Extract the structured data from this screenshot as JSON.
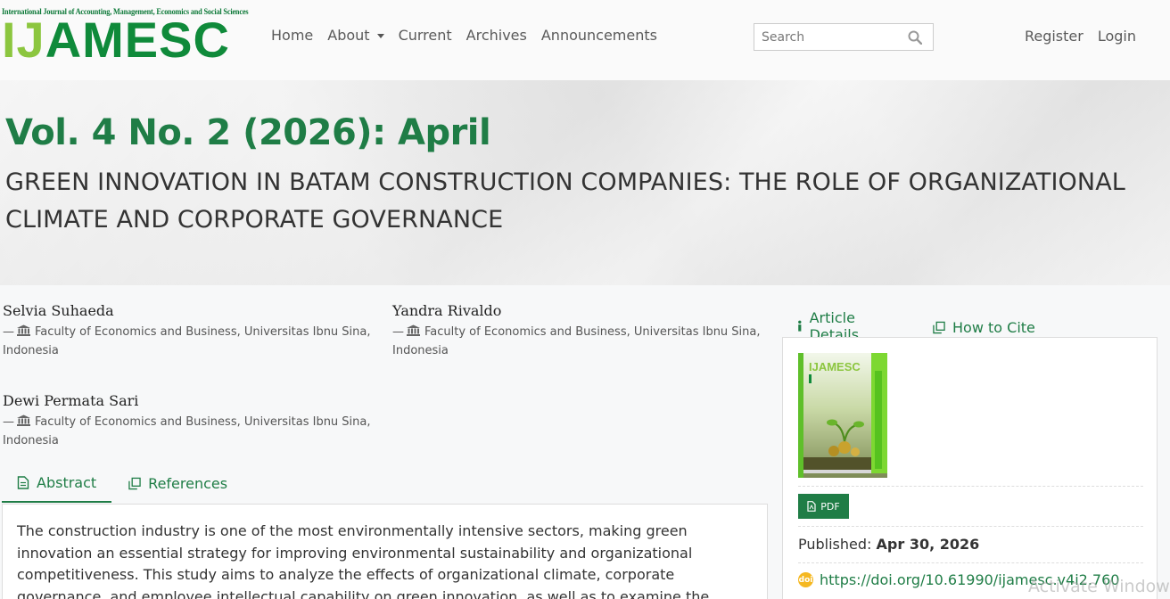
{
  "brand": {
    "tagline": "International Journal of Accounting, Management, Economics and Social Sciences",
    "wordmark_a": "IJ",
    "wordmark_b": "AMESC"
  },
  "nav": {
    "home": "Home",
    "about": "About",
    "current": "Current",
    "archives": "Archives",
    "announcements": "Announcements"
  },
  "search": {
    "placeholder": "Search"
  },
  "user_nav": {
    "register": "Register",
    "login": "Login"
  },
  "issue": {
    "title": "Vol. 4 No. 2 (2026): April",
    "article_title": "GREEN INNOVATION IN BATAM CONSTRUCTION COMPANIES: THE ROLE OF ORGANIZATIONAL CLIMATE AND CORPORATE GOVERNANCE"
  },
  "authors": [
    {
      "name": "Selvia Suhaeda",
      "dash": "—",
      "affiliation": "Faculty of Economics and Business, Universitas Ibnu Sina, Indonesia"
    },
    {
      "name": "Yandra Rivaldo",
      "dash": "—",
      "affiliation": "Faculty of Economics and Business, Universitas Ibnu Sina, Indonesia"
    },
    {
      "name": "Dewi Permata Sari",
      "dash": "—",
      "affiliation": "Faculty of Economics and Business, Universitas Ibnu Sina, Indonesia"
    }
  ],
  "content_tabs": {
    "abstract": "Abstract",
    "references": "References"
  },
  "abstract_text": "The construction industry is one of the most environmentally intensive sectors, making green innovation an essential strategy for improving environmental sustainability and organizational competitiveness. This study aims to analyze the effects of organizational climate, corporate governance, and employee intellectual capability on green innovation, as well as to examine the moderating role of green transformational leadership",
  "sidebar": {
    "tabs": {
      "details": "Article Details",
      "cite": "How to Cite"
    },
    "cover": {
      "brand": "IJAMESC",
      "subtitle": "International Journal of Accounting, Management, Economics and Social Sciences"
    },
    "pdf_label": "PDF",
    "published_label": "Published:",
    "published_date": "Apr 30, 2026",
    "doi_badge": "doi",
    "doi": "https://doi.org/10.61990/ijamesc.v4i2.760"
  },
  "watermark": "Activate Windows",
  "colors": {
    "primary": "#1f7d46",
    "brand_light": "#8cc63f",
    "brand_dark": "#0f8a3a"
  }
}
